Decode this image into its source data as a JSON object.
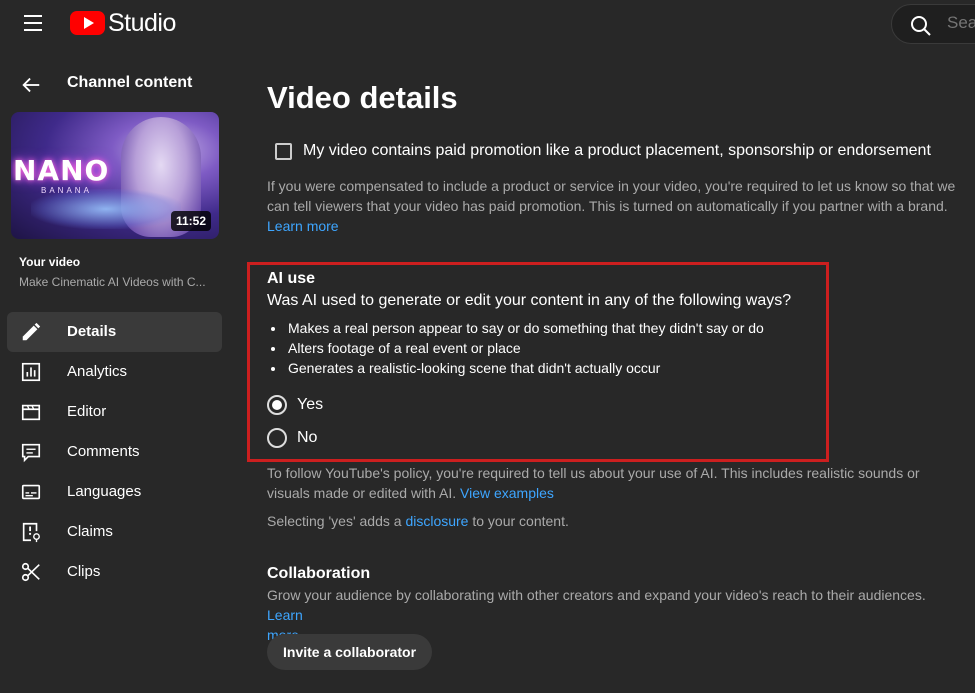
{
  "topbar": {
    "logo_text": "Studio",
    "search_placeholder": "Search across your channel"
  },
  "sidebar": {
    "title": "Channel content",
    "thumbnail": {
      "title_text": "NANO",
      "subtitle_text": "BANANA",
      "duration": "11:52"
    },
    "your_video_label": "Your video",
    "video_title": "Make Cinematic AI Videos with C...",
    "items": [
      {
        "label": "Details",
        "icon": "pencil-icon",
        "active": true
      },
      {
        "label": "Analytics",
        "icon": "analytics-icon",
        "active": false
      },
      {
        "label": "Editor",
        "icon": "editor-icon",
        "active": false
      },
      {
        "label": "Comments",
        "icon": "comments-icon",
        "active": false
      },
      {
        "label": "Languages",
        "icon": "languages-icon",
        "active": false
      },
      {
        "label": "Claims",
        "icon": "claims-icon",
        "active": false
      },
      {
        "label": "Clips",
        "icon": "scissors-icon",
        "active": false
      }
    ]
  },
  "main": {
    "title": "Video details",
    "paid_promotion": {
      "label": "My video contains paid promotion like a product placement, sponsorship or endorsement",
      "checked": false,
      "description_line1": "If you were compensated to include a product or service in your video, you're required to let us know so that we",
      "description_line2": "can tell viewers that your video has paid promotion. This is turned on automatically if you partner with a brand.",
      "learn_more": "Learn more"
    },
    "ai_use": {
      "heading": "AI use",
      "question": "Was AI used to generate or edit your content in any of the following ways?",
      "bullets": [
        "Makes a real person appear to say or do something that they didn't say or do",
        "Alters footage of a real event or place",
        "Generates a realistic-looking scene that didn't actually occur"
      ],
      "options": [
        {
          "label": "Yes",
          "selected": true
        },
        {
          "label": "No",
          "selected": false
        }
      ],
      "highlight_color": "#cc1f1f",
      "policy_line1": "To follow YouTube's policy, you're required to tell us about your use of AI. This includes realistic sounds or",
      "policy_line2_prefix": "visuals made or edited with AI.",
      "view_examples": "View examples",
      "selecting_prefix": "Selecting 'yes' adds a",
      "disclosure": "disclosure",
      "selecting_suffix": "to your content."
    },
    "collaboration": {
      "heading": "Collaboration",
      "description": "Grow your audience by collaborating with other creators and expand your video's reach to their audiences.",
      "learn_more_1": "Learn",
      "learn_more_2": "more",
      "invite_button": "Invite a collaborator"
    }
  },
  "colors": {
    "background": "#282828",
    "link": "#3ea6ff",
    "brand": "#ff0000"
  }
}
